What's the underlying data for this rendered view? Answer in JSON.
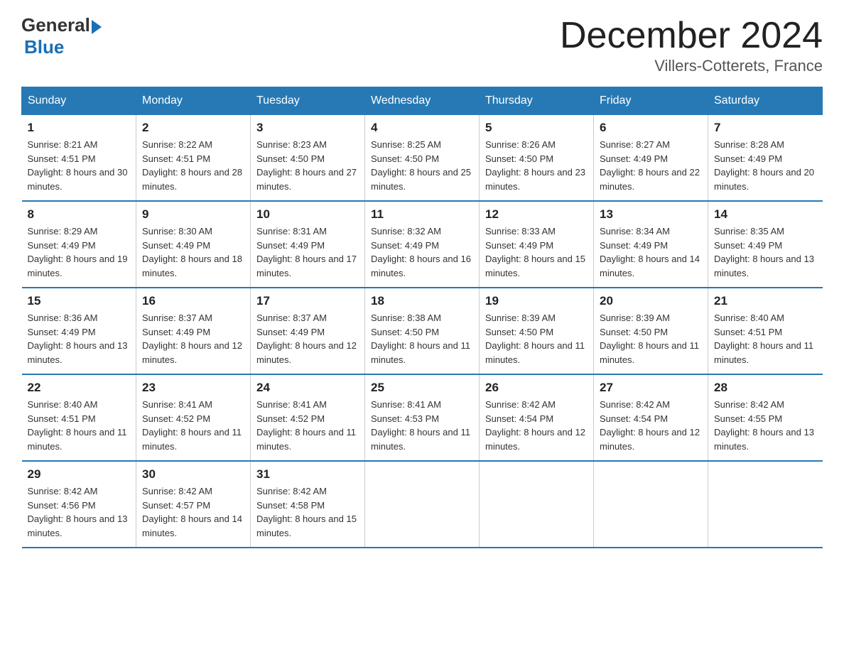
{
  "logo": {
    "general": "General",
    "blue": "Blue"
  },
  "title": "December 2024",
  "location": "Villers-Cotterets, France",
  "days_of_week": [
    "Sunday",
    "Monday",
    "Tuesday",
    "Wednesday",
    "Thursday",
    "Friday",
    "Saturday"
  ],
  "weeks": [
    [
      {
        "day": "1",
        "sunrise": "8:21 AM",
        "sunset": "4:51 PM",
        "daylight": "8 hours and 30 minutes."
      },
      {
        "day": "2",
        "sunrise": "8:22 AM",
        "sunset": "4:51 PM",
        "daylight": "8 hours and 28 minutes."
      },
      {
        "day": "3",
        "sunrise": "8:23 AM",
        "sunset": "4:50 PM",
        "daylight": "8 hours and 27 minutes."
      },
      {
        "day": "4",
        "sunrise": "8:25 AM",
        "sunset": "4:50 PM",
        "daylight": "8 hours and 25 minutes."
      },
      {
        "day": "5",
        "sunrise": "8:26 AM",
        "sunset": "4:50 PM",
        "daylight": "8 hours and 23 minutes."
      },
      {
        "day": "6",
        "sunrise": "8:27 AM",
        "sunset": "4:49 PM",
        "daylight": "8 hours and 22 minutes."
      },
      {
        "day": "7",
        "sunrise": "8:28 AM",
        "sunset": "4:49 PM",
        "daylight": "8 hours and 20 minutes."
      }
    ],
    [
      {
        "day": "8",
        "sunrise": "8:29 AM",
        "sunset": "4:49 PM",
        "daylight": "8 hours and 19 minutes."
      },
      {
        "day": "9",
        "sunrise": "8:30 AM",
        "sunset": "4:49 PM",
        "daylight": "8 hours and 18 minutes."
      },
      {
        "day": "10",
        "sunrise": "8:31 AM",
        "sunset": "4:49 PM",
        "daylight": "8 hours and 17 minutes."
      },
      {
        "day": "11",
        "sunrise": "8:32 AM",
        "sunset": "4:49 PM",
        "daylight": "8 hours and 16 minutes."
      },
      {
        "day": "12",
        "sunrise": "8:33 AM",
        "sunset": "4:49 PM",
        "daylight": "8 hours and 15 minutes."
      },
      {
        "day": "13",
        "sunrise": "8:34 AM",
        "sunset": "4:49 PM",
        "daylight": "8 hours and 14 minutes."
      },
      {
        "day": "14",
        "sunrise": "8:35 AM",
        "sunset": "4:49 PM",
        "daylight": "8 hours and 13 minutes."
      }
    ],
    [
      {
        "day": "15",
        "sunrise": "8:36 AM",
        "sunset": "4:49 PM",
        "daylight": "8 hours and 13 minutes."
      },
      {
        "day": "16",
        "sunrise": "8:37 AM",
        "sunset": "4:49 PM",
        "daylight": "8 hours and 12 minutes."
      },
      {
        "day": "17",
        "sunrise": "8:37 AM",
        "sunset": "4:49 PM",
        "daylight": "8 hours and 12 minutes."
      },
      {
        "day": "18",
        "sunrise": "8:38 AM",
        "sunset": "4:50 PM",
        "daylight": "8 hours and 11 minutes."
      },
      {
        "day": "19",
        "sunrise": "8:39 AM",
        "sunset": "4:50 PM",
        "daylight": "8 hours and 11 minutes."
      },
      {
        "day": "20",
        "sunrise": "8:39 AM",
        "sunset": "4:50 PM",
        "daylight": "8 hours and 11 minutes."
      },
      {
        "day": "21",
        "sunrise": "8:40 AM",
        "sunset": "4:51 PM",
        "daylight": "8 hours and 11 minutes."
      }
    ],
    [
      {
        "day": "22",
        "sunrise": "8:40 AM",
        "sunset": "4:51 PM",
        "daylight": "8 hours and 11 minutes."
      },
      {
        "day": "23",
        "sunrise": "8:41 AM",
        "sunset": "4:52 PM",
        "daylight": "8 hours and 11 minutes."
      },
      {
        "day": "24",
        "sunrise": "8:41 AM",
        "sunset": "4:52 PM",
        "daylight": "8 hours and 11 minutes."
      },
      {
        "day": "25",
        "sunrise": "8:41 AM",
        "sunset": "4:53 PM",
        "daylight": "8 hours and 11 minutes."
      },
      {
        "day": "26",
        "sunrise": "8:42 AM",
        "sunset": "4:54 PM",
        "daylight": "8 hours and 12 minutes."
      },
      {
        "day": "27",
        "sunrise": "8:42 AM",
        "sunset": "4:54 PM",
        "daylight": "8 hours and 12 minutes."
      },
      {
        "day": "28",
        "sunrise": "8:42 AM",
        "sunset": "4:55 PM",
        "daylight": "8 hours and 13 minutes."
      }
    ],
    [
      {
        "day": "29",
        "sunrise": "8:42 AM",
        "sunset": "4:56 PM",
        "daylight": "8 hours and 13 minutes."
      },
      {
        "day": "30",
        "sunrise": "8:42 AM",
        "sunset": "4:57 PM",
        "daylight": "8 hours and 14 minutes."
      },
      {
        "day": "31",
        "sunrise": "8:42 AM",
        "sunset": "4:58 PM",
        "daylight": "8 hours and 15 minutes."
      },
      null,
      null,
      null,
      null
    ]
  ]
}
